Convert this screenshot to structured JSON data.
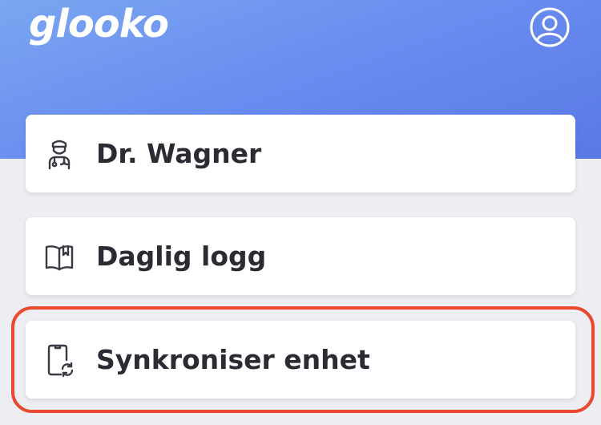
{
  "header": {
    "logo_text": "glooko",
    "profile_icon": "user-circle-icon",
    "gradient_colors": [
      "#7aa6f0",
      "#5a78e6"
    ]
  },
  "menu": {
    "items": [
      {
        "label": "Dr. Wagner",
        "icon": "doctor-icon"
      },
      {
        "label": "Daglig logg",
        "icon": "book-icon"
      },
      {
        "label": "Synkroniser enhet",
        "icon": "phone-sync-icon"
      }
    ]
  },
  "highlight": {
    "color": "#e8492f",
    "target": "Synkroniser enhet"
  }
}
